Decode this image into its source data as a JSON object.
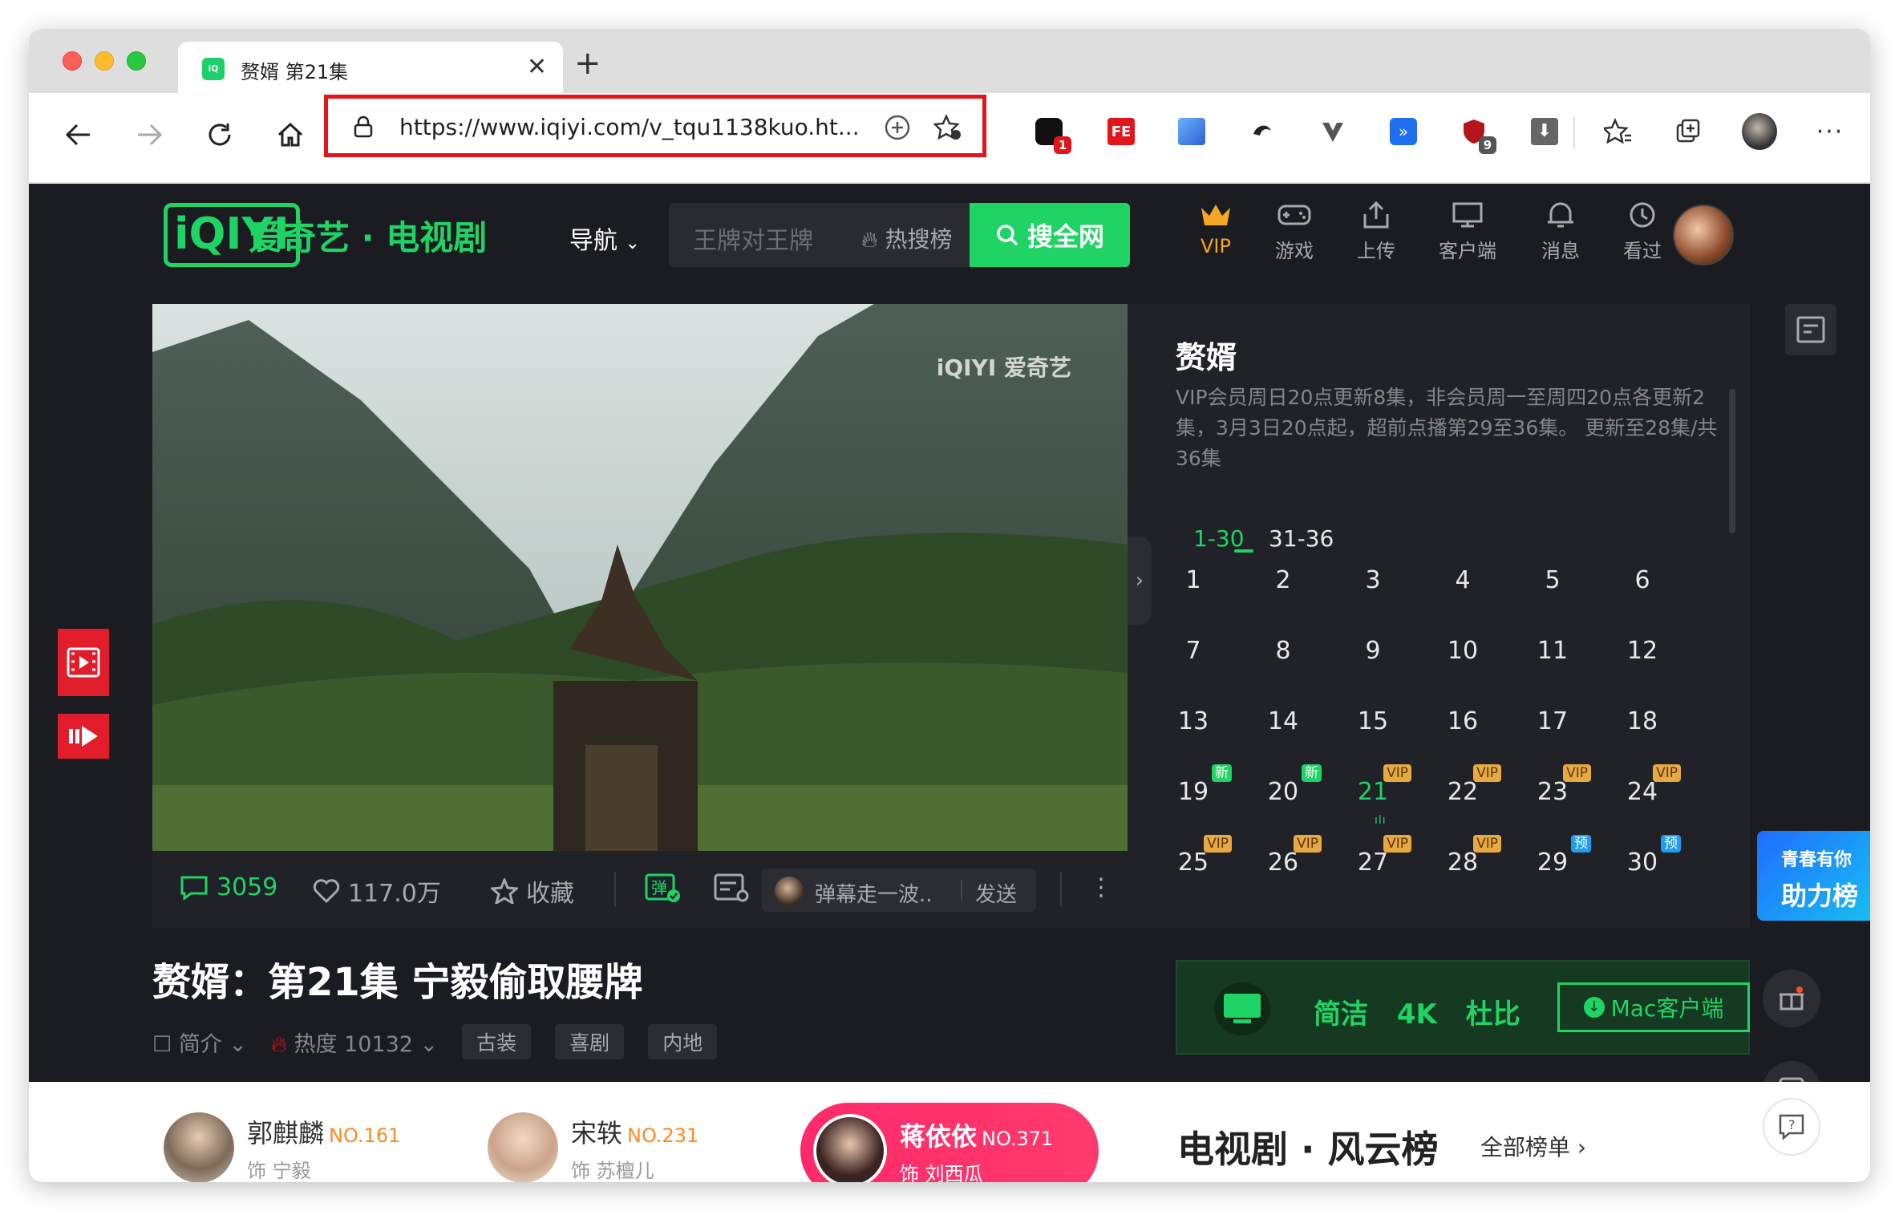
{
  "browser": {
    "tab_title": "赘婿 第21集",
    "favicon_text": "iQIYI",
    "url": "https://www.iqiyi.com/v_tqu1138kuo.ht...",
    "extensions": [
      {
        "name": "ext-1",
        "badge": "1",
        "badge_color": "#e3151b"
      },
      {
        "name": "ext-fe",
        "label": "FE"
      },
      {
        "name": "ext-2"
      },
      {
        "name": "ext-3"
      },
      {
        "name": "ext-4"
      },
      {
        "name": "ext-5"
      },
      {
        "name": "ext-shield",
        "badge": "9",
        "badge_color": "#555555"
      },
      {
        "name": "ext-download"
      }
    ]
  },
  "site": {
    "logo": "iQIYI",
    "logo_text": "爱奇艺 · 电视剧",
    "nav_label": "导航",
    "search_placeholder": "王牌对王牌",
    "hot_rank": "热搜榜",
    "search_button": "搜全网",
    "header_icons": [
      {
        "name": "vip",
        "label": "VIP",
        "color": "#f5a623"
      },
      {
        "name": "game",
        "label": "游戏"
      },
      {
        "name": "upload",
        "label": "上传"
      },
      {
        "name": "client",
        "label": "客户端"
      },
      {
        "name": "message",
        "label": "消息"
      },
      {
        "name": "history",
        "label": "看过"
      }
    ]
  },
  "video": {
    "watermark": "iQIYI 爱奇艺",
    "comment_count": "3059",
    "like_count": "117.0万",
    "collect_label": "收藏",
    "danmu_placeholder": "弹幕走一波..",
    "send_label": "发送",
    "more_label": "⋮"
  },
  "panel": {
    "title": "赘婿",
    "description": "VIP会员周日20点更新8集，非会员周一至周四20点各更新2集，3月3日20点起，超前点播第29至36集。 更新至28集/共36集",
    "ranges": [
      {
        "label": "1-30",
        "active": true
      },
      {
        "label": "31-36",
        "active": false
      }
    ],
    "episodes": [
      {
        "n": "1",
        "tag": ""
      },
      {
        "n": "2",
        "tag": ""
      },
      {
        "n": "3",
        "tag": ""
      },
      {
        "n": "4",
        "tag": ""
      },
      {
        "n": "5",
        "tag": ""
      },
      {
        "n": "6",
        "tag": ""
      },
      {
        "n": "7",
        "tag": ""
      },
      {
        "n": "8",
        "tag": ""
      },
      {
        "n": "9",
        "tag": ""
      },
      {
        "n": "10",
        "tag": ""
      },
      {
        "n": "11",
        "tag": ""
      },
      {
        "n": "12",
        "tag": ""
      },
      {
        "n": "13",
        "tag": ""
      },
      {
        "n": "14",
        "tag": ""
      },
      {
        "n": "15",
        "tag": ""
      },
      {
        "n": "16",
        "tag": ""
      },
      {
        "n": "17",
        "tag": ""
      },
      {
        "n": "18",
        "tag": ""
      },
      {
        "n": "19",
        "tag": "新"
      },
      {
        "n": "20",
        "tag": "新"
      },
      {
        "n": "21",
        "tag": "VIP",
        "active": true
      },
      {
        "n": "22",
        "tag": "VIP"
      },
      {
        "n": "23",
        "tag": "VIP"
      },
      {
        "n": "24",
        "tag": "VIP"
      },
      {
        "n": "25",
        "tag": "VIP"
      },
      {
        "n": "26",
        "tag": "VIP"
      },
      {
        "n": "27",
        "tag": "VIP"
      },
      {
        "n": "28",
        "tag": "VIP"
      },
      {
        "n": "29",
        "tag": "预"
      },
      {
        "n": "30",
        "tag": "预"
      }
    ]
  },
  "title_area": {
    "episode_title": "赘婿：第21集 宁毅偷取腰牌",
    "intro_label": "简介",
    "heat_label": "热度 10132",
    "genres": [
      "古装",
      "喜剧",
      "内地"
    ],
    "client_modes": "简洁 4K 杜比",
    "client_button": "Mac客户端"
  },
  "youth": {
    "top": "青春有你",
    "bottom": "助力榜"
  },
  "cast": [
    {
      "name": "郭麒麟",
      "no": "NO.161",
      "role": "饰 宁毅",
      "highlight": false
    },
    {
      "name": "宋轶",
      "no": "NO.231",
      "role": "饰 苏檀儿",
      "highlight": false
    },
    {
      "name": "蒋依依",
      "no": "NO.371",
      "role": "饰 刘西瓜",
      "highlight": true
    }
  ],
  "ranking": {
    "title": "电视剧 · 风云榜",
    "all_label": "全部榜单 ›"
  }
}
